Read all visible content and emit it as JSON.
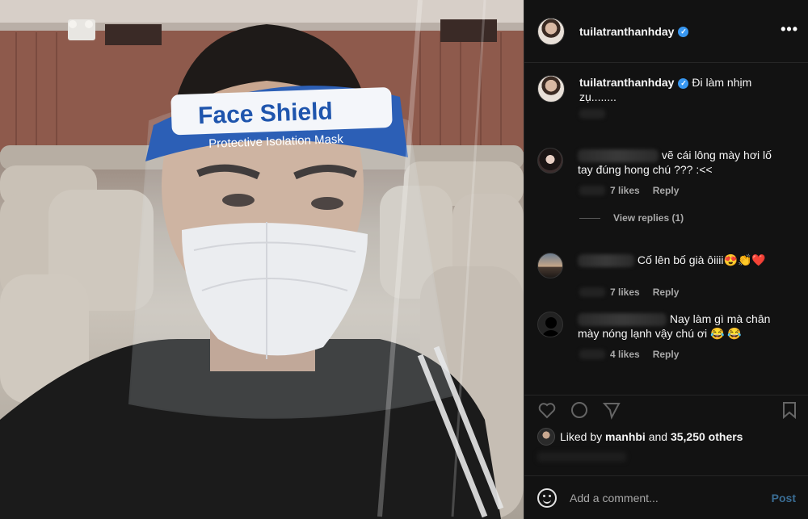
{
  "post": {
    "author": "tuilatranthanhday",
    "author_avatar_icon": "profile-photo-icon",
    "verified_icon": "verified-badge-icon",
    "more_icon": "ellipsis-icon",
    "more_label": "•••",
    "verified_glyph": "✓",
    "photo": {
      "shield_title": "Face Shield",
      "shield_subtitle": "Protective Isolation Mask"
    }
  },
  "caption": {
    "username": "tuilatranthanhday",
    "text": "Đi làm nhịm zụ........"
  },
  "comments": [
    {
      "text": "vẽ cái lông mày hơi lố tay đúng hong chú ??? :<<",
      "likes": "7 likes",
      "reply": "Reply",
      "view_replies": "View replies (1)"
    },
    {
      "text": "Cố lên bố già ôiiii😍👏❤️",
      "likes": "7 likes",
      "reply": "Reply"
    },
    {
      "text": "Nay làm gì mà chân mày nóng lạnh vậy chú ơi 😂 😂",
      "likes": "4 likes",
      "reply": "Reply"
    }
  ],
  "liked_by": {
    "prefix": "Liked by ",
    "user": "manhbi",
    "middle": " and ",
    "others": "35,250 others"
  },
  "add_comment": {
    "placeholder": "Add a comment...",
    "post_label": "Post"
  },
  "colors": {
    "panel_bg": "#121212",
    "verified": "#3897f0",
    "post_button": "#3a6d94"
  }
}
